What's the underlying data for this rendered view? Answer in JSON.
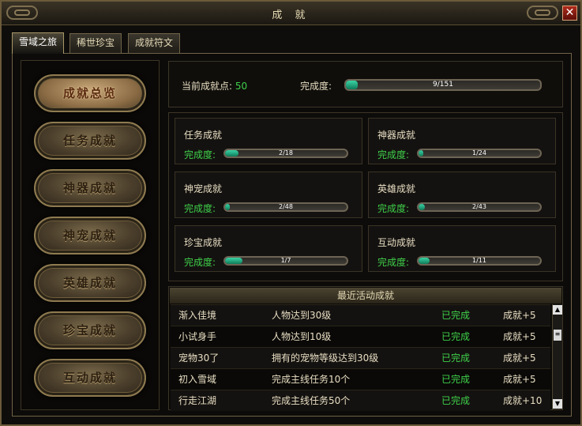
{
  "window": {
    "title": "成 就"
  },
  "tabs": [
    {
      "label": "雪域之旅",
      "active": true
    },
    {
      "label": "稀世珍宝",
      "active": false
    },
    {
      "label": "成就符文",
      "active": false
    }
  ],
  "sidebar": {
    "items": [
      {
        "label": "成就总览",
        "active": true
      },
      {
        "label": "任务成就",
        "active": false
      },
      {
        "label": "神器成就",
        "active": false
      },
      {
        "label": "神宠成就",
        "active": false
      },
      {
        "label": "英雄成就",
        "active": false
      },
      {
        "label": "珍宝成就",
        "active": false
      },
      {
        "label": "互动成就",
        "active": false
      }
    ]
  },
  "summary": {
    "points_label": "当前成就点:",
    "points_value": "50",
    "completion_label": "完成度:",
    "progress_text": "9/151",
    "progress_fraction": 0.06
  },
  "categories": [
    {
      "name": "任务成就",
      "completion_label": "完成度:",
      "progress_text": "2/18",
      "progress_fraction": 0.11
    },
    {
      "name": "神器成就",
      "completion_label": "完成度:",
      "progress_text": "1/24",
      "progress_fraction": 0.04
    },
    {
      "name": "神宠成就",
      "completion_label": "完成度:",
      "progress_text": "2/48",
      "progress_fraction": 0.04
    },
    {
      "name": "英雄成就",
      "completion_label": "完成度:",
      "progress_text": "2/43",
      "progress_fraction": 0.05
    },
    {
      "name": "珍宝成就",
      "completion_label": "完成度:",
      "progress_text": "1/7",
      "progress_fraction": 0.14
    },
    {
      "name": "互动成就",
      "completion_label": "完成度:",
      "progress_text": "1/11",
      "progress_fraction": 0.09
    }
  ],
  "recent": {
    "header": "最近活动成就",
    "rows": [
      {
        "name": "渐入佳境",
        "desc": "人物达到30级",
        "status": "已完成",
        "reward": "成就+5"
      },
      {
        "name": "小试身手",
        "desc": "人物达到10级",
        "status": "已完成",
        "reward": "成就+5"
      },
      {
        "name": "宠物30了",
        "desc": "拥有的宠物等级达到30级",
        "status": "已完成",
        "reward": "成就+5"
      },
      {
        "name": "初入雪域",
        "desc": "完成主线任务10个",
        "status": "已完成",
        "reward": "成就+5"
      },
      {
        "name": "行走江湖",
        "desc": "完成主线任务50个",
        "status": "已完成",
        "reward": "成就+10"
      }
    ]
  },
  "icons": {
    "close": "close-icon",
    "scroll_up": "arrow-up-icon",
    "scroll_down": "arrow-down-icon",
    "scroll_thumb": "grip-icon"
  },
  "colors": {
    "accent_green": "#3fd04a",
    "progress_fill": "#1fb08a",
    "frame_gold": "#8f7b50"
  }
}
